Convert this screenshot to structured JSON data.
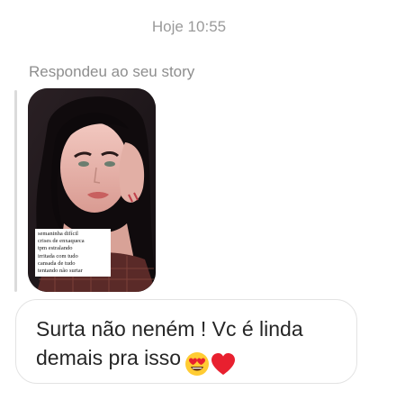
{
  "timestamp": "Hoje 10:55",
  "reply_label": "Respondeu ao seu story",
  "story": {
    "caption_lines": [
      "semaninha difícil",
      "crises de enxaqueca",
      "tpm estralando",
      "irritada com tudo",
      "cansada de tudo",
      "tentando não surtar"
    ]
  },
  "message": {
    "line1": "Surta não neném ! Vc é linda",
    "line2": "demais pra isso",
    "emojis": [
      "heart-eyes-emoji",
      "red-heart-emoji"
    ]
  },
  "colors": {
    "timestamp": "#9a9a9a",
    "reply_label": "#8e8e8e",
    "message_text": "#262626",
    "bubble_border": "#e3e3e3",
    "heart": "#e8202f",
    "smiley": "#ffcc33"
  }
}
